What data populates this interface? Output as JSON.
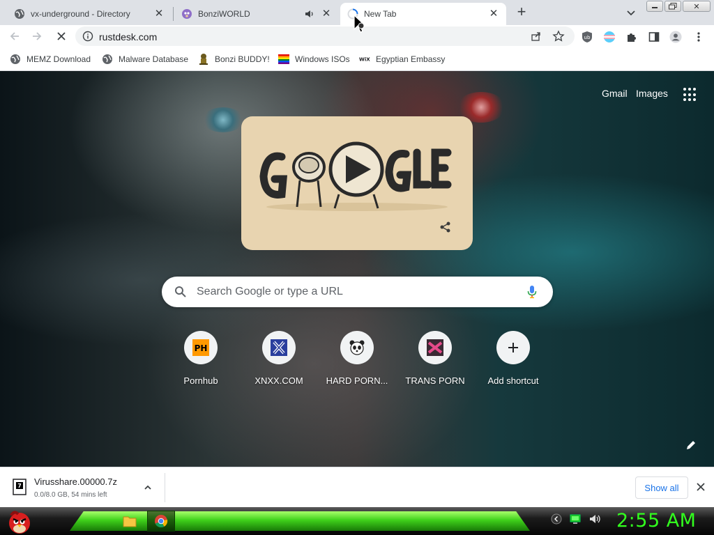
{
  "tabs": [
    {
      "title": "vx-underground - Directory",
      "icon": "globe-icon"
    },
    {
      "title": "BonziWORLD",
      "icon": "bonzi-icon",
      "audio": true
    },
    {
      "title": "New Tab",
      "icon": "loading-icon",
      "active": true
    }
  ],
  "toolbar": {
    "url": "rustdesk.com"
  },
  "bookmarks": [
    {
      "label": "MEMZ Download",
      "icon": "globe-icon"
    },
    {
      "label": "Malware Database",
      "icon": "globe-icon"
    },
    {
      "label": "Bonzi BUDDY!",
      "icon": "bonzi-buddy-icon"
    },
    {
      "label": "Windows ISOs",
      "icon": "rainbow-flag-icon"
    },
    {
      "label": "Egyptian Embassy",
      "icon": "wix-icon"
    }
  ],
  "ntp": {
    "gmail": "Gmail",
    "images": "Images",
    "search_placeholder": "Search Google or type a URL",
    "shortcuts": [
      {
        "label": "Pornhub",
        "icon": "ph-icon"
      },
      {
        "label": "XNXX.COM",
        "icon": "x-icon"
      },
      {
        "label": "HARD PORN...",
        "icon": "panda-icon"
      },
      {
        "label": "TRANS PORN",
        "icon": "pink-icon"
      },
      {
        "label": "Add shortcut",
        "icon": "plus-icon"
      }
    ]
  },
  "download": {
    "filename": "Virusshare.00000.7z",
    "status": "0.0/8.0 GB, 54 mins left",
    "show_all": "Show all"
  },
  "taskbar": {
    "clock": "2:55 AM",
    "accent": "#32ff1e"
  }
}
